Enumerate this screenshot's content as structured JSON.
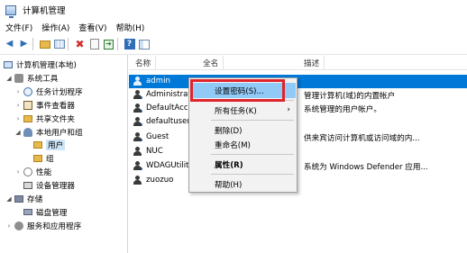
{
  "window": {
    "title": "计算机管理"
  },
  "menu": [
    "文件(F)",
    "操作(A)",
    "查看(V)",
    "帮助(H)"
  ],
  "toolbar": {
    "icons": [
      "back-arrow-icon",
      "forward-arrow-icon",
      "folder-up-icon",
      "show-hide-tree-icon",
      "delete-icon",
      "properties-icon",
      "export-list-icon",
      "help-icon",
      "action-pane-icon"
    ]
  },
  "tree": {
    "root": "计算机管理(本地)",
    "system_tools": "系统工具",
    "task_scheduler": "任务计划程序",
    "event_viewer": "事件查看器",
    "shared_folders": "共享文件夹",
    "local_users_groups": "本地用户和组",
    "users": "用户",
    "groups": "组",
    "performance": "性能",
    "device_manager": "设备管理器",
    "storage": "存储",
    "disk_management": "磁盘管理",
    "services_apps": "服务和应用程序"
  },
  "list": {
    "columns": [
      "名称",
      "全名",
      "描述"
    ],
    "rows": [
      {
        "name": "admin",
        "fullname": "",
        "description": ""
      },
      {
        "name": "Administrat...",
        "fullname": "",
        "description": "管理计算机(域)的内置帐户"
      },
      {
        "name": "DefaultAcc...",
        "fullname": "",
        "description": "系统管理的用户帐户。"
      },
      {
        "name": "defaultuser...",
        "fullname": "",
        "description": ""
      },
      {
        "name": "Guest",
        "fullname": "",
        "description": "供来宾访问计算机或访问域的内..."
      },
      {
        "name": "NUC",
        "fullname": "",
        "description": ""
      },
      {
        "name": "WDAGUtilit...",
        "fullname": "",
        "description": "系统为 Windows Defender 应用..."
      },
      {
        "name": "zuozuo",
        "fullname": "",
        "description": ""
      }
    ]
  },
  "context_menu": {
    "set_password": "设置密码(S)...",
    "all_tasks": "所有任务(K)",
    "delete": "删除(D)",
    "rename": "重命名(M)",
    "properties": "属性(R)",
    "help": "帮助(H)"
  },
  "colors": {
    "selection": "#0078d7",
    "menu_hover": "#91c9f7",
    "highlight_box": "#e0242b",
    "tree_selected": "#cce4f7"
  }
}
